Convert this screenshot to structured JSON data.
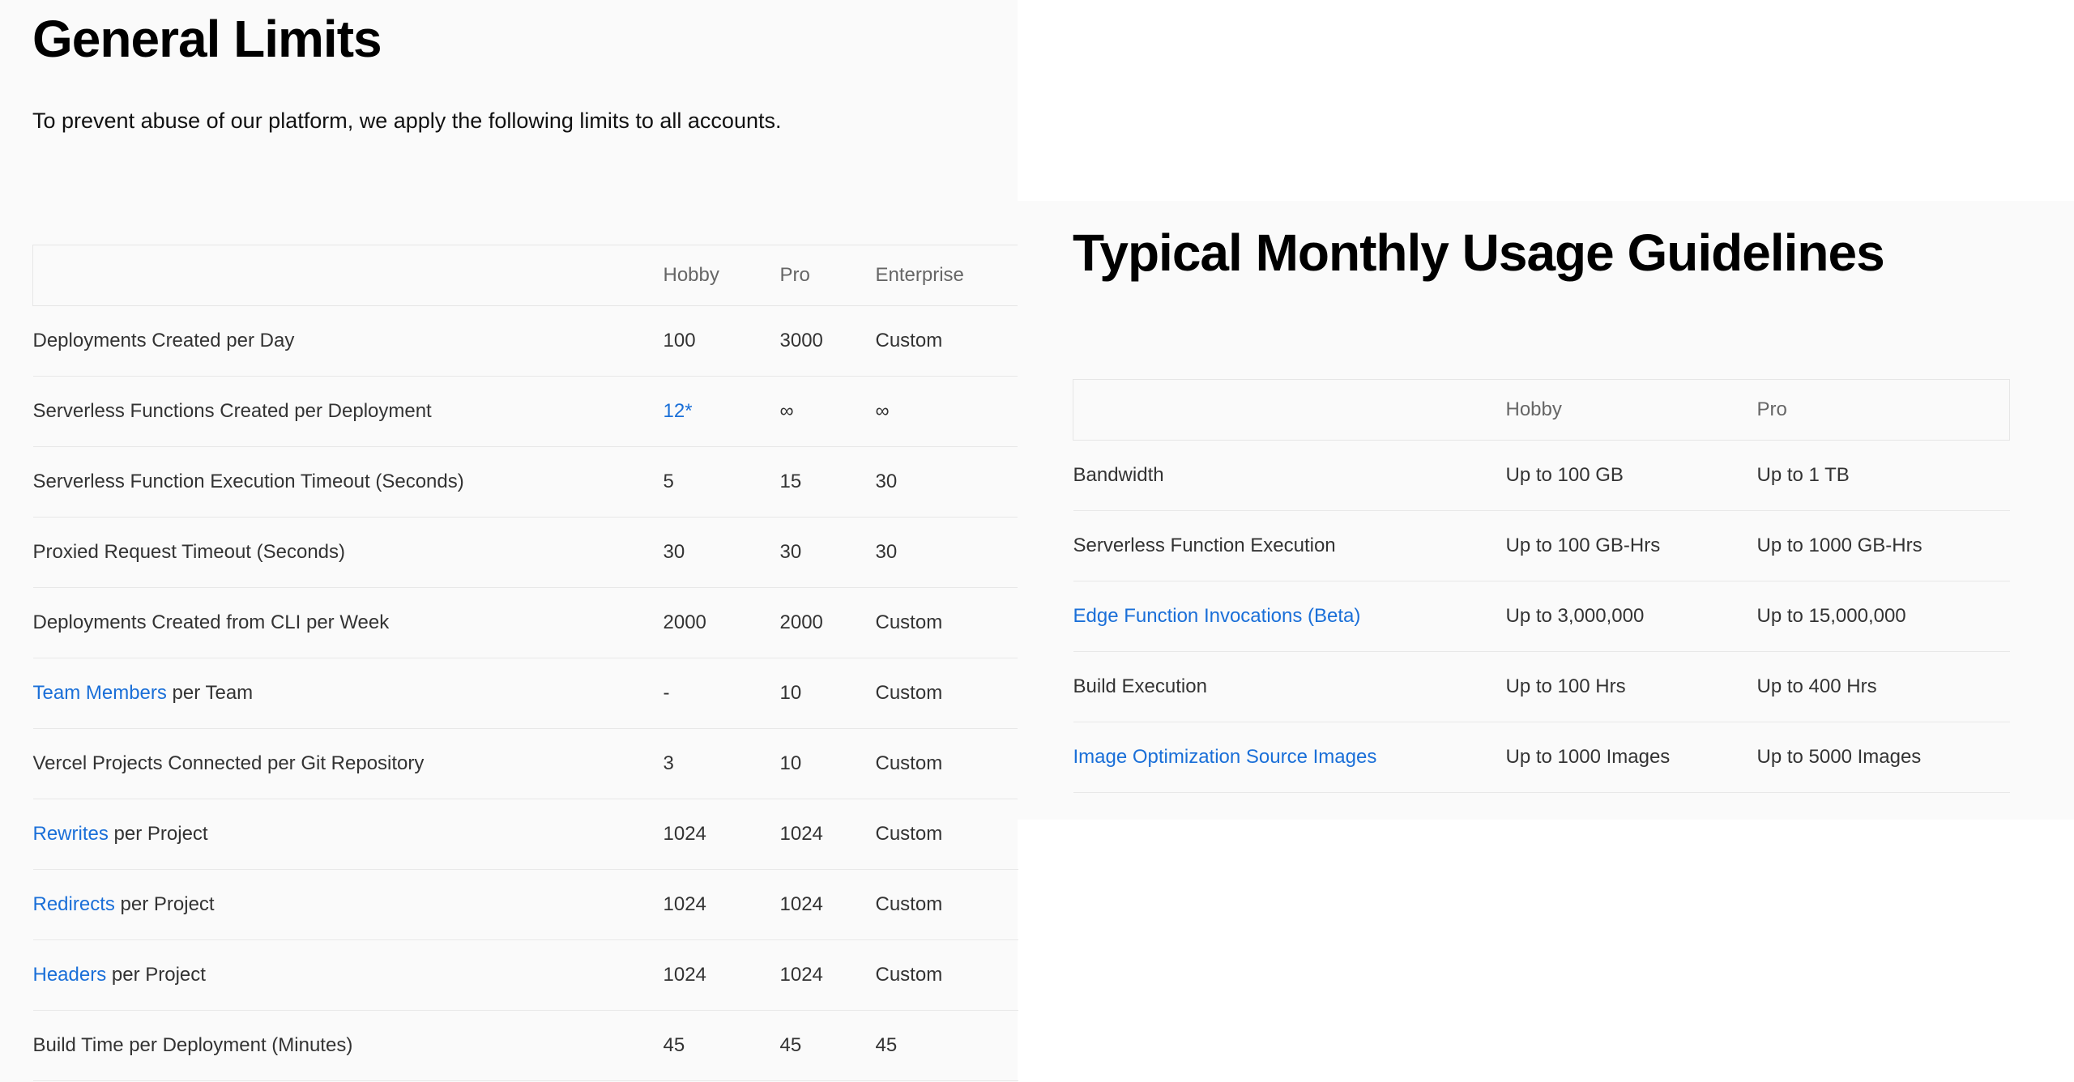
{
  "general": {
    "title": "General Limits",
    "intro": "To prevent abuse of our platform, we apply the following limits to all accounts.",
    "columns": [
      "",
      "Hobby",
      "Pro",
      "Enterprise"
    ],
    "rows": [
      {
        "link": "",
        "label": "Deployments Created per Day",
        "hobby": "100",
        "pro": "3000",
        "enterprise": "Custom"
      },
      {
        "link": "",
        "label": "Serverless Functions Created per Deployment",
        "hobby": "12*",
        "pro": "∞",
        "enterprise": "∞"
      },
      {
        "link": "",
        "label": "Serverless Function Execution Timeout (Seconds)",
        "hobby": "5",
        "pro": "15",
        "enterprise": "30"
      },
      {
        "link": "",
        "label": "Proxied Request Timeout (Seconds)",
        "hobby": "30",
        "pro": "30",
        "enterprise": "30"
      },
      {
        "link": "",
        "label": "Deployments Created from CLI per Week",
        "hobby": "2000",
        "pro": "2000",
        "enterprise": "Custom"
      },
      {
        "link": "Team Members",
        "label": " per Team",
        "hobby": "-",
        "pro": "10",
        "enterprise": "Custom"
      },
      {
        "link": "",
        "label": "Vercel Projects Connected per Git Repository",
        "hobby": "3",
        "pro": "10",
        "enterprise": "Custom"
      },
      {
        "link": "Rewrites",
        "label": " per Project",
        "hobby": "1024",
        "pro": "1024",
        "enterprise": "Custom"
      },
      {
        "link": "Redirects",
        "label": " per Project",
        "hobby": "1024",
        "pro": "1024",
        "enterprise": "Custom"
      },
      {
        "link": "Headers",
        "label": " per Project",
        "hobby": "1024",
        "pro": "1024",
        "enterprise": "Custom"
      },
      {
        "link": "",
        "label": "Build Time per Deployment (Minutes)",
        "hobby": "45",
        "pro": "45",
        "enterprise": "45"
      }
    ]
  },
  "usage": {
    "title": "Typical Monthly Usage Guidelines",
    "columns": [
      "",
      "Hobby",
      "Pro"
    ],
    "rows": [
      {
        "link": "",
        "label": "Bandwidth",
        "hobby": "Up to 100 GB",
        "pro": "Up to 1 TB"
      },
      {
        "link": "",
        "label": "Serverless Function Execution",
        "hobby": "Up to 100 GB-Hrs",
        "pro": "Up to 1000 GB-Hrs"
      },
      {
        "link": "Edge Function Invocations (Beta)",
        "label": "",
        "hobby": "Up to 3,000,000",
        "pro": "Up to 15,000,000"
      },
      {
        "link": "",
        "label": "Build Execution",
        "hobby": "Up to 100 Hrs",
        "pro": "Up to 400 Hrs"
      },
      {
        "link": "Image Optimization Source Images",
        "label": "",
        "hobby": "Up to 1000 Images",
        "pro": "Up to 5000 Images"
      }
    ]
  },
  "colors": {
    "panel_bg": "#fafafa",
    "link": "#1a6fd8",
    "text": "#333333",
    "header_text": "#666666",
    "border": "#e6e6e6"
  }
}
